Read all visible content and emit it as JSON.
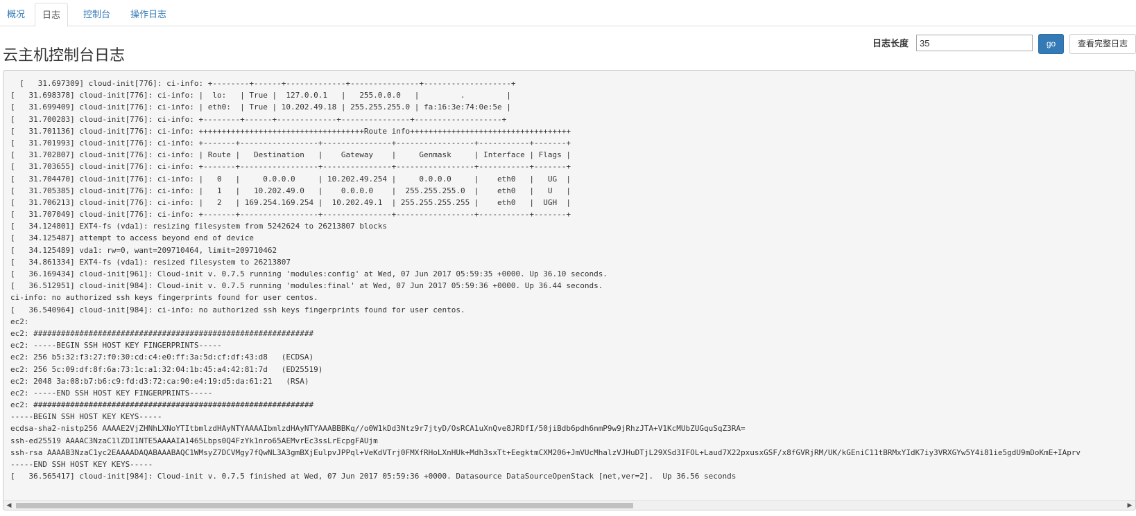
{
  "tabs": [
    {
      "label": "概况",
      "active": false
    },
    {
      "label": "日志",
      "active": true
    },
    {
      "label": "控制台",
      "active": false
    },
    {
      "label": "操作日志",
      "active": false
    }
  ],
  "page_title": "云主机控制台日志",
  "controls": {
    "length_label": "日志长度",
    "length_value": "35",
    "go_label": "go",
    "full_log_label": "查看完整日志"
  },
  "colors": {
    "accent": "#337ab7",
    "log_background": "#f5f5f5"
  },
  "log_lines": [
    "  [   31.697309] cloud-init[776]: ci-info: +--------+------+-------------+---------------+-------------------+",
    "[   31.698378] cloud-init[776]: ci-info: |  lo:   | True |  127.0.0.1   |   255.0.0.0   |         .         |",
    "[   31.699409] cloud-init[776]: ci-info: | eth0:  | True | 10.202.49.18 | 255.255.255.0 | fa:16:3e:74:0e:5e |",
    "[   31.700283] cloud-init[776]: ci-info: +--------+------+-------------+---------------+-------------------+",
    "[   31.701136] cloud-init[776]: ci-info: ++++++++++++++++++++++++++++++++++++Route info+++++++++++++++++++++++++++++++++++",
    "[   31.701993] cloud-init[776]: ci-info: +-------+-----------------+---------------+-----------------+-----------+-------+",
    "[   31.702807] cloud-init[776]: ci-info: | Route |   Destination   |    Gateway    |     Genmask     | Interface | Flags |",
    "[   31.703655] cloud-init[776]: ci-info: +-------+-----------------+---------------+-----------------+-----------+-------+",
    "[   31.704470] cloud-init[776]: ci-info: |   0   |     0.0.0.0     | 10.202.49.254 |     0.0.0.0     |    eth0   |   UG  |",
    "[   31.705385] cloud-init[776]: ci-info: |   1   |   10.202.49.0   |    0.0.0.0    |  255.255.255.0  |    eth0   |   U   |",
    "[   31.706213] cloud-init[776]: ci-info: |   2   | 169.254.169.254 |  10.202.49.1  | 255.255.255.255 |    eth0   |  UGH  |",
    "[   31.707049] cloud-init[776]: ci-info: +-------+-----------------+---------------+-----------------+-----------+-------+",
    "[   34.124801] EXT4-fs (vda1): resizing filesystem from 5242624 to 26213807 blocks",
    "[   34.125487] attempt to access beyond end of device",
    "[   34.125489] vda1: rw=0, want=209710464, limit=209710462",
    "[   34.861334] EXT4-fs (vda1): resized filesystem to 26213807",
    "[   36.169434] cloud-init[961]: Cloud-init v. 0.7.5 running 'modules:config' at Wed, 07 Jun 2017 05:59:35 +0000. Up 36.10 seconds.",
    "[   36.512951] cloud-init[984]: Cloud-init v. 0.7.5 running 'modules:final' at Wed, 07 Jun 2017 05:59:36 +0000. Up 36.44 seconds.",
    "ci-info: no authorized ssh keys fingerprints found for user centos.",
    "[   36.540964] cloud-init[984]: ci-info: no authorized ssh keys fingerprints found for user centos.",
    "ec2:",
    "ec2: #############################################################",
    "ec2: -----BEGIN SSH HOST KEY FINGERPRINTS-----",
    "ec2: 256 b5:32:f3:27:f0:30:cd:c4:e0:ff:3a:5d:cf:df:43:d8   (ECDSA)",
    "ec2: 256 5c:09:df:8f:6a:73:1c:a1:32:04:1b:45:a4:42:81:7d   (ED25519)",
    "ec2: 2048 3a:08:b7:b6:c9:fd:d3:72:ca:90:e4:19:d5:da:61:21   (RSA)",
    "ec2: -----END SSH HOST KEY FINGERPRINTS-----",
    "ec2: #############################################################",
    "-----BEGIN SSH HOST KEY KEYS-----",
    "ecdsa-sha2-nistp256 AAAAE2VjZHNhLXNoYTItbmlzdHAyNTYAAAAIbmlzdHAyNTYAAABBBKq//o0W1kDd3Ntz9r7jtyD/OsRCA1uXnQve8JRDfI/50jiBdb6pdh6nmP9w9jRhzJTA+V1KcMUbZUGquSqZ3RA=",
    "ssh-ed25519 AAAAC3NzaC1lZDI1NTE5AAAAIA1465Lbps0Q4FzYk1nro65AEMvrEc3ssLrEcpgFAUjm",
    "ssh-rsa AAAAB3NzaC1yc2EAAAADAQABAAABAQC1WMsyZ7DCVMgy7fQwNL3A3gmBXjEulpvJPPql+VeKdVTrj0FMXfRHoLXnHUk+Mdh3sxTt+EegktmCXM206+JmVUcMhalzVJHuDTjL29XSd3IFOL+Laud7X22pxusxGSF/x8fGVRjRM/UK/kGEniC11tBRMxYIdK7iy3VRXGYw5Y4i81ie5gdU9mDoKmE+IAprv",
    "-----END SSH HOST KEY KEYS-----",
    "[   36.565417] cloud-init[984]: Cloud-init v. 0.7.5 finished at Wed, 07 Jun 2017 05:59:36 +0000. Datasource DataSourceOpenStack [net,ver=2].  Up 36.56 seconds"
  ]
}
